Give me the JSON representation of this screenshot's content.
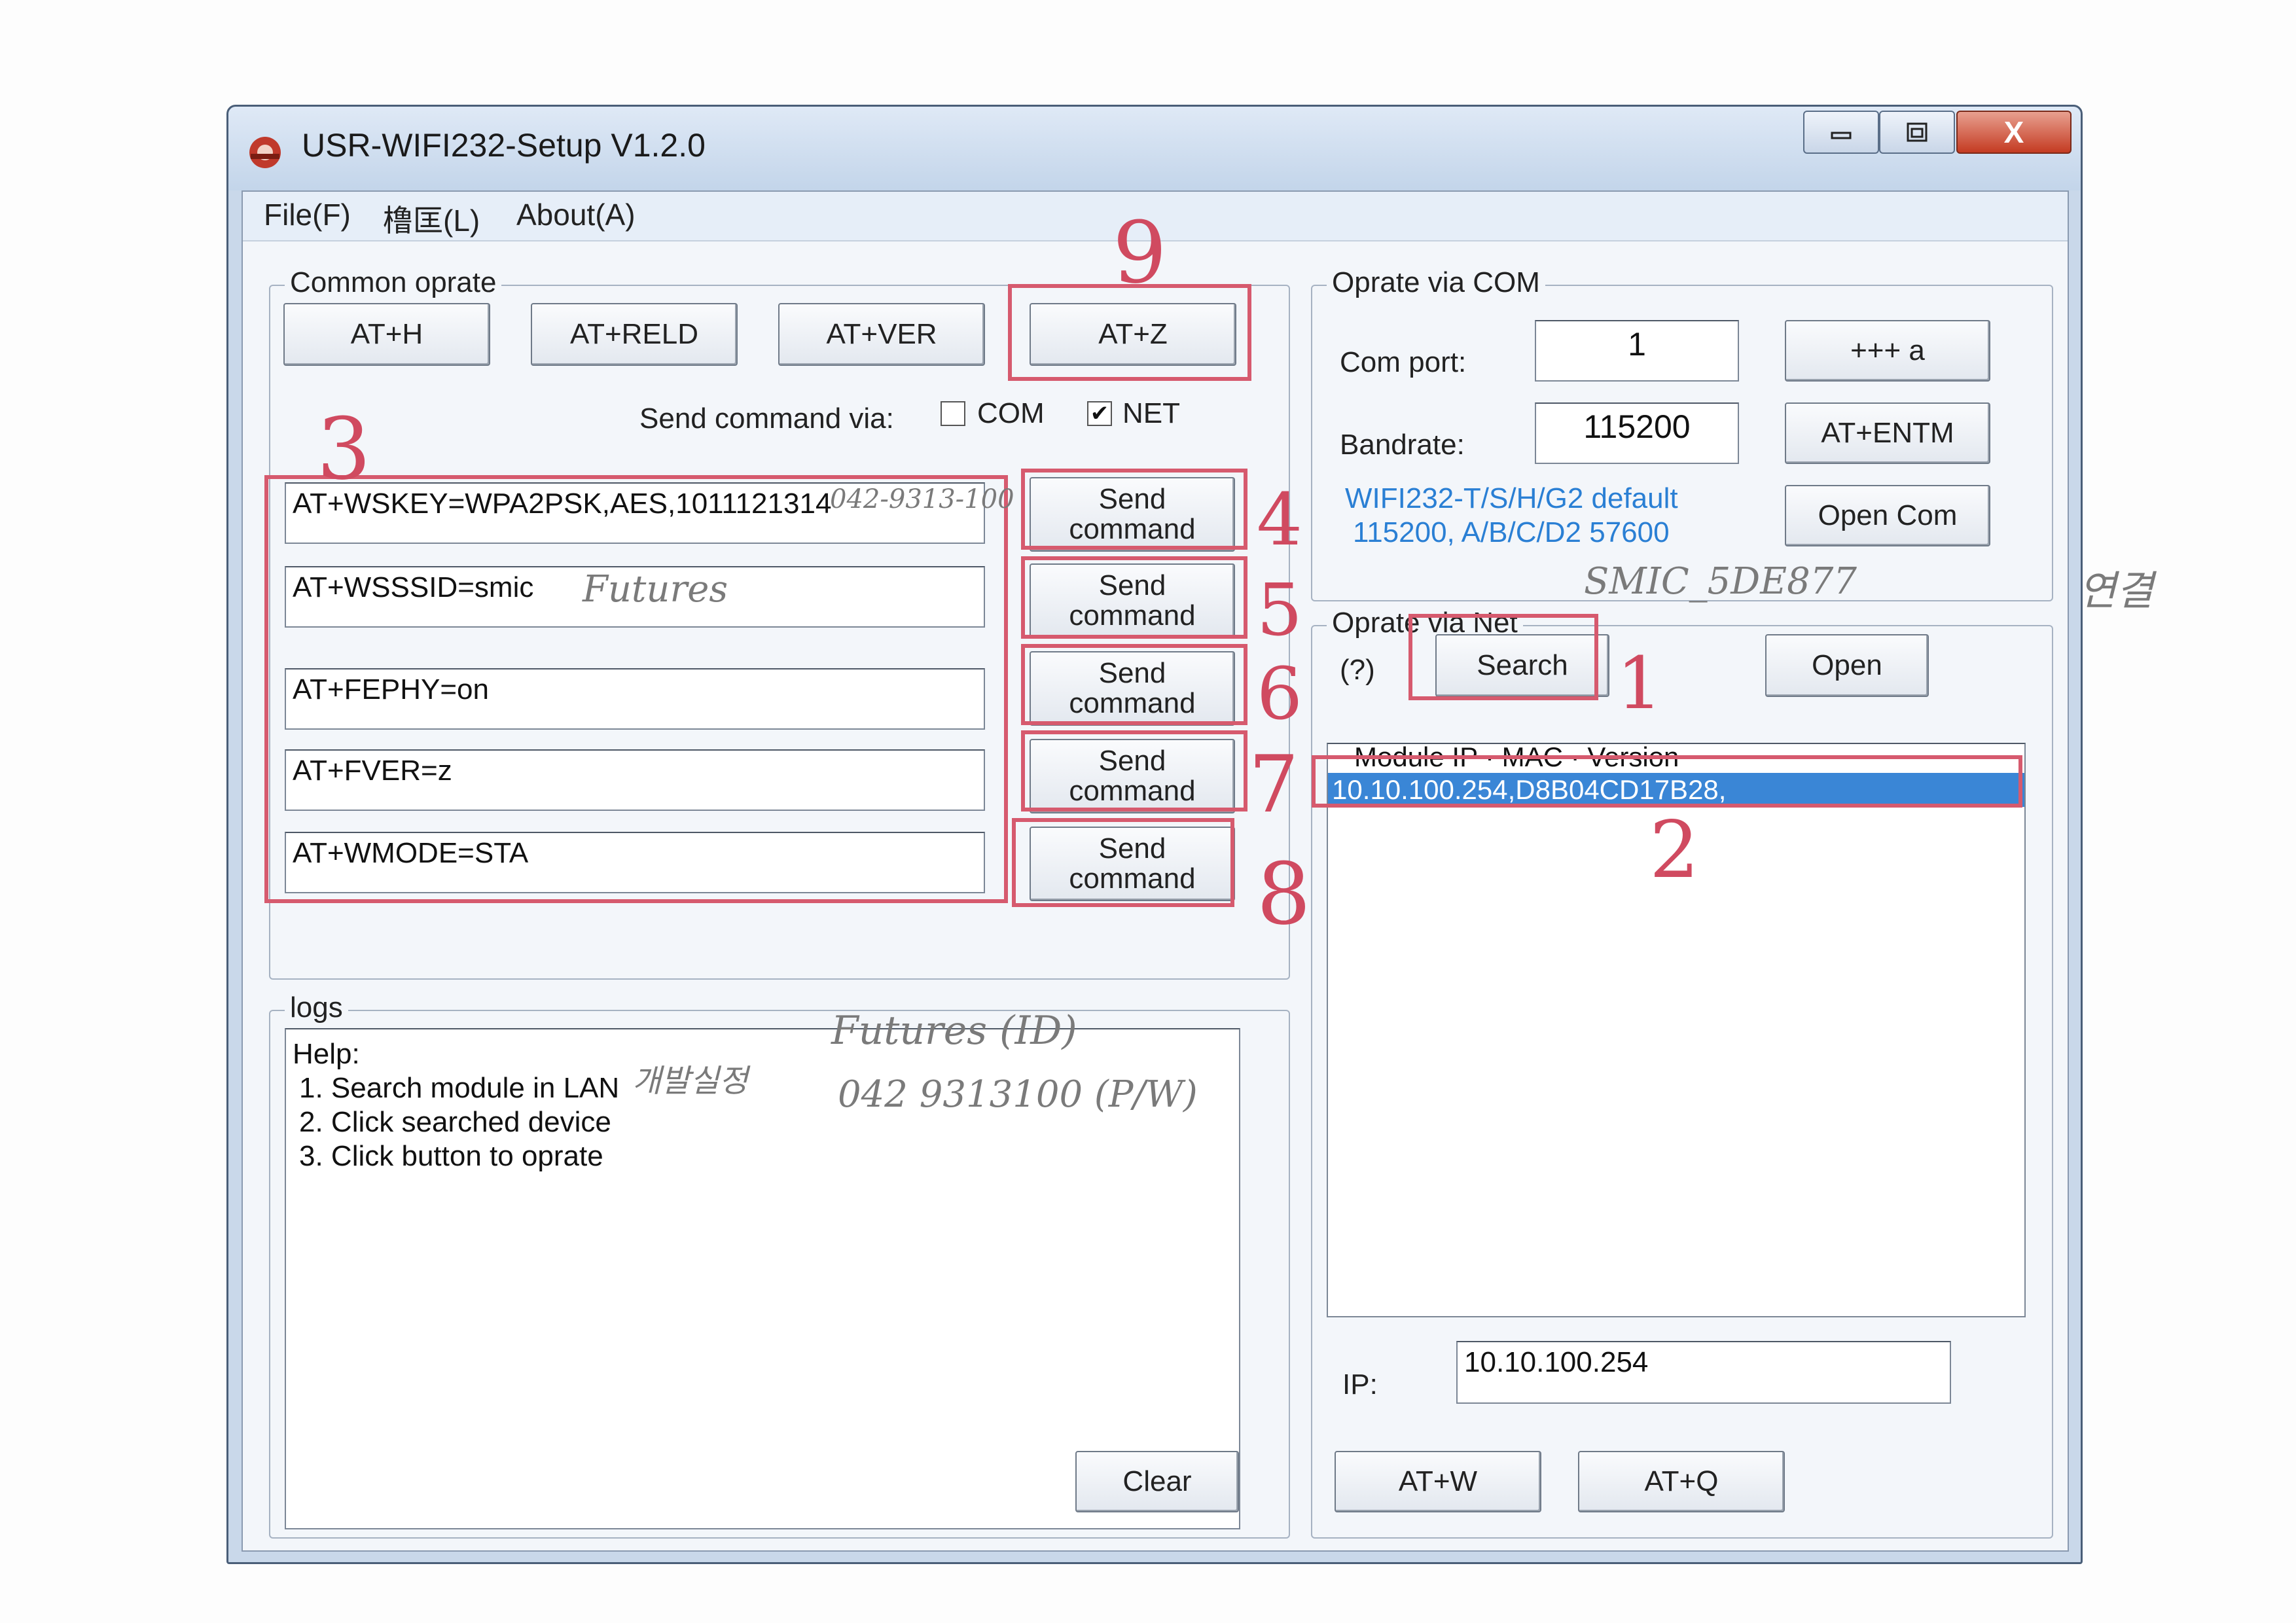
{
  "window": {
    "title": "USR-WIFI232-Setup V1.2.0",
    "close_glyph": "X"
  },
  "menu": {
    "file": "File(F)",
    "lang": "橹匡(L)",
    "about": "About(A)"
  },
  "common": {
    "legend": "Common oprate",
    "buttons": [
      "AT+H",
      "AT+RELD",
      "AT+VER",
      "AT+Z"
    ],
    "send_via_label": "Send command via:",
    "com_label": "COM",
    "net_label": "NET",
    "com_checked": false,
    "net_checked": true,
    "commands": [
      "AT+WSKEY=WPA2PSK,AES,1011121314",
      "AT+WSSSID=smic",
      "AT+FEPHY=on",
      "AT+FVER=z",
      "AT+WMODE=STA"
    ],
    "send_label": "Send command"
  },
  "com": {
    "legend": "Oprate via COM",
    "port_label": "Com port:",
    "port_value": "1",
    "baud_label": "Bandrate:",
    "baud_value": "115200",
    "btn_plus": "+++ a",
    "btn_entm": "AT+ENTM",
    "btn_open": "Open Com",
    "note_line1": "WIFI232-T/S/H/G2 default",
    "note_line2": "115200, A/B/C/D2 57600"
  },
  "net": {
    "legend": "Oprate via Net",
    "help": "(?)",
    "search": "Search",
    "open": "Open",
    "list_header": "Module IP  ·  MAC  ·  Version",
    "list_items": [
      "10.10.100.254,D8B04CD17B28,"
    ],
    "ip_label": "IP:",
    "ip_value": "10.10.100.254",
    "btn_atw": "AT+W",
    "btn_atq": "AT+Q"
  },
  "logs": {
    "legend": "logs",
    "lines": [
      "Help:",
      " 1. Search module in LAN",
      " 2. Click searched device",
      " 3. Click button to oprate"
    ],
    "clear": "Clear"
  },
  "annotations": {
    "num1": "1",
    "num2": "2",
    "num3": "3",
    "num4": "4",
    "num5": "5",
    "num6": "6",
    "num7": "7",
    "num8": "8",
    "num9": "9",
    "note_key": "042-9313-100",
    "note_ssid": "Futures",
    "note_top": "SMIC_5DE877",
    "note_top_ko": "연결",
    "note_log_ko": "개발실정",
    "note_log1": "Futures (ID)",
    "note_log2": "042 9313100 (P/W)"
  },
  "colors": {
    "annotation_red": "#d65a6e",
    "selection_blue": "#3a86d6",
    "note_blue": "#2a7fd4"
  }
}
